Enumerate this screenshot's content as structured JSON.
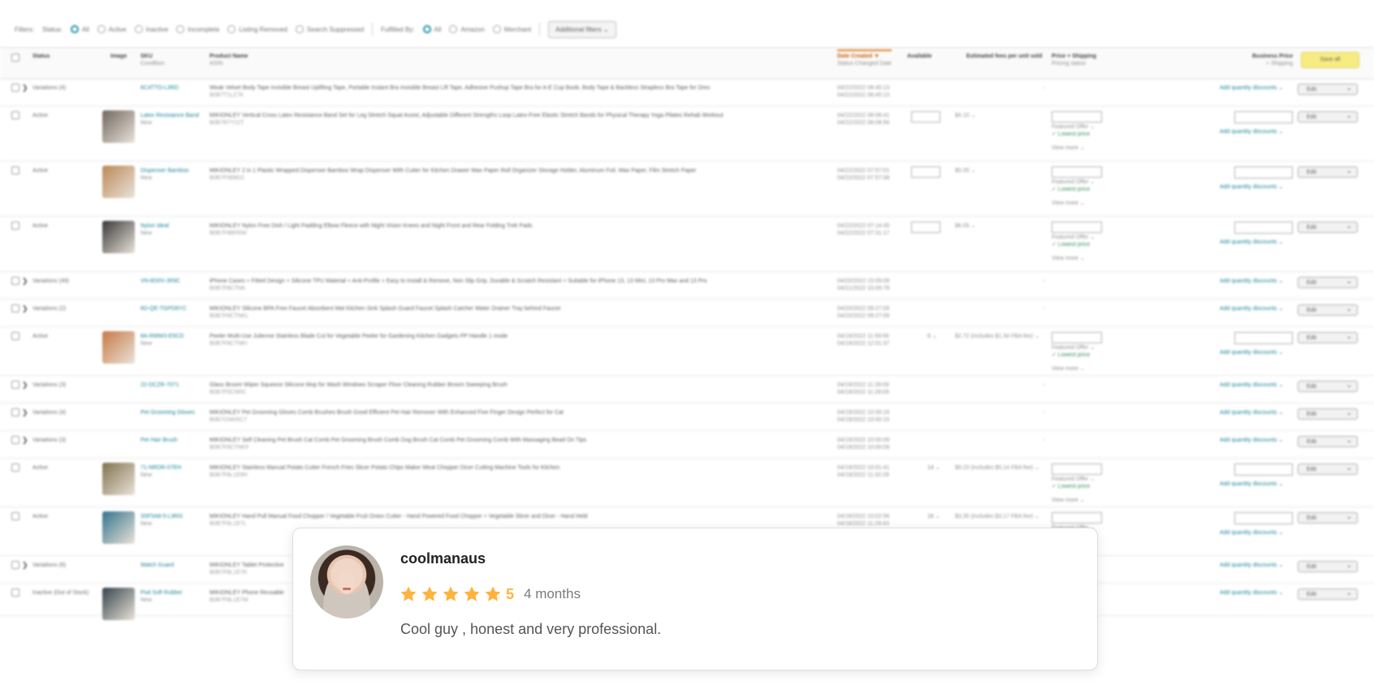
{
  "filters": {
    "label": "Filters:",
    "status_label": "Status:",
    "status_options": [
      "All",
      "Active",
      "Inactive",
      "Incomplete",
      "Listing Removed",
      "Search Suppressed"
    ],
    "fulfilled_label": "Fulfilled By:",
    "fulfilled_options": [
      "All",
      "Amazon",
      "Merchant"
    ],
    "additional": "Additional filters ⌄"
  },
  "table_headers": {
    "status": "Status",
    "image": "Image",
    "sku": "SKU",
    "sku_sub": "Condition",
    "product": "Product Name",
    "product_sub": "ASIN",
    "date": "Date Created ▼",
    "date_sub": "Status Changed Date",
    "available": "Available",
    "fees": "Estimated fees per unit sold",
    "price": "Price + Shipping",
    "price_sub": "Pricing status",
    "business": "Business Price",
    "business_sub": "+ Shipping",
    "save_all": "Save all"
  },
  "rows": [
    {
      "status": "Variations (4)",
      "variation": true,
      "sku": "6C4TTO-L3RD",
      "cond": "",
      "name": "Weak Velvet Body Tape Invisible Breast Uplifting Tape, Portable Instant Bra Invisible Breast Lift Tape, Adhesive Pushup Tape Bra for A-E Cup Boob, Body Tape & Backless Strapless Bra Tape for Dres",
      "asin": "B0B7T1LZ7K",
      "date": "04/22/2022 08:45:13",
      "date2": "04/22/2022 08:45:13"
    },
    {
      "status": "Active",
      "sku": "Latex Resistance Band",
      "cond": "New",
      "name": "MIKIONLEY Vertical Cross Latex Resistance Band Set for Leg Stretch Squat Assist, Adjustable Different Strengths Loop Latex-Free Elastic Stretch Bands for Physical Therapy Yoga Pilates Rehab Workout",
      "asin": "B0B7R7Y11T",
      "date": "04/22/2022 08:08:41",
      "date2": "04/22/2022 08:08:50",
      "fees": "$4.10",
      "avail": true,
      "price": "10.91"
    },
    {
      "status": "Active",
      "sku": "Dispenser Bamboo",
      "cond": "New",
      "name": "MIKIONLEY 2 in 1 Plastic Wrapped Dispenser Bamboo Wrap Dispenser With Cutter for Kitchen Drawer Wax Paper Roll Organizer Storage Holder, Aluminum Foil, Wax Paper, Film Stretch Paper",
      "asin": "B0B7F5B8D2",
      "date": "04/22/2022 07:57:01",
      "date2": "04/22/2022 07:57:08",
      "fees": "$5.05",
      "avail": true,
      "price": "19.99"
    },
    {
      "status": "Active",
      "sku": "Nylon Ideal",
      "cond": "New",
      "name": "MIKIONLEY Nylon Free Dish / Light Padding Elbow Fleece with Night Vision Knees and Night Front and Rear Folding Trek Pads",
      "asin": "B0B7F8BFRW",
      "date": "04/22/2022 07:14:45",
      "date2": "04/22/2022 07:31:17",
      "fees": "$6.05",
      "avail": true,
      "price": "28.99"
    },
    {
      "status": "Variations (49)",
      "variation": true,
      "sku": "VN-8D0V-JR9C",
      "cond": "",
      "name": "iPhone Cases + Fitted Design + Silicone TPU Material + Anti-Profile + Easy to Install & Remove, Non Slip Grip, Durable & Scratch Resistant + Suitable for iPhone 13, 13 Mini, 13 Pro Max and 13 Pro",
      "asin": "B0B7F8CTNK",
      "date": "04/20/2022 15:09:09",
      "date2": "04/21/2022 15:09:78"
    },
    {
      "status": "Variations (2)",
      "variation": true,
      "sku": "6D-QE-TGPD6YC",
      "cond": "",
      "name": "MIKIONLEY Silicone BPA Free Faucet Absorbent Mat Kitchen Sink Splash Guard Faucet Splash Catcher Water Drainer Tray behind Faucet",
      "asin": "B0B7F8CTNKL",
      "date": "04/20/2022 09:27:09",
      "date2": "04/20/2022 09:27:09"
    },
    {
      "status": "Active",
      "sku": "8A-RMW3-E5CD",
      "cond": "New",
      "name": "Peeler Multi-Use Julienne Stainless Blade Cut for Vegetable Peeler for Gardening Kitchen Gadgets PP Handle 1 mode",
      "asin": "B0B7F8CTNKI",
      "date": "04/19/2022 11:59:56",
      "date2": "04/19/2022 12:01:37",
      "fees": "$2.72 (includes $1.34 FBA fee)",
      "avail_text": "0",
      "price": "10.91"
    },
    {
      "status": "Variations (3)",
      "variation": true,
      "sku": "22-DCZR-7071",
      "cond": "",
      "name": "Glass Broom Wiper Squeeze Silicone Mop for Wash Windows Scraper Floor Cleaning Rubber Broom Sweeping Brush",
      "asin": "B0B7F5CNRC",
      "date": "04/19/2022 11:28:09",
      "date2": "04/19/2022 11:28:09"
    },
    {
      "status": "Variations (4)",
      "variation": true,
      "sku": "Pet Grooming Gloves",
      "cond": "",
      "name": "MIKIONLEY Pet Grooming Gloves Comb Brushes Brush Good Efficient Pet Hair Remover With Enhanced Five Finger Design Perfect for Cat",
      "asin": "B0B7CNKRC7",
      "date": "04/19/2022 10:00:16",
      "date2": "04/19/2022 10:00:15"
    },
    {
      "status": "Variations (3)",
      "variation": true,
      "sku": "Pet Hair Brush",
      "cond": "",
      "name": "MIKIONLEY Self Cleaning Pet Brush Cat Comb Pet Grooming Brush Comb Dog Brush Cat Comb Pet Grooming Comb With Massaging Bead On Tips",
      "asin": "B0B7F8CTNKF",
      "date": "04/19/2022 10:00:09",
      "date2": "04/19/2022 10:00:09"
    },
    {
      "status": "Active",
      "sku": "71-NRDR-07EH",
      "cond": "New",
      "name": "MIKIONLEY Stainless Manual Potato Cutter French Fries Slicer Potato Chips Maker Meat Chopper Dicer Cutting Machine Tools for Kitchen",
      "asin": "B0B7F8L1E9H",
      "date": "04/19/2022 10:01:41",
      "date2": "04/19/2022 11:32:28",
      "fees": "$9.23 (includes $5.14 FBA fee)",
      "avail_text": "14",
      "price": "49.99"
    },
    {
      "status": "Active",
      "sku": "3SF5A8-5-L9RG",
      "cond": "New",
      "name": "MIKIONLEY Hand Pull Manual Food Chopper / Vegetable Fruit Onion Cutter - Hand Powered Food Chopper + Vegetable Slicer and Dicer - Hand Held",
      "asin": "B0B7F8L1E7L",
      "date": "04/18/2022 10:02:56",
      "date2": "04/18/2022 11:29:43",
      "fees": "$3.35 (includes $3.17 FBA fee)",
      "avail_text": "16",
      "price": "13.98"
    },
    {
      "status": "Variations (6)",
      "variation": true,
      "sku": "Watch Guard",
      "cond": "",
      "name": "MIKIONLEY Tablet Protective",
      "asin": "B0B7F8L1E7K",
      "date": "",
      "date2": ""
    },
    {
      "status": "Inactive (Out of Stock)",
      "sku": "Pod Soft Rubber",
      "cond": "New",
      "name": "MIKIONLEY Phone Reusable",
      "asin": "B0B7F8L1E7M",
      "date": "",
      "date2": ""
    }
  ],
  "row_ui": {
    "edit": "Edit",
    "qd": "Add quantity discounts",
    "view_more": "View more ⌄",
    "lowest": "Lowest price",
    "featured": "Featured Offer"
  },
  "review": {
    "name": "coolmanaus",
    "rating": "5",
    "stars": 5,
    "time": "4 months",
    "text": "Cool guy , honest and very professional.",
    "star_color": "#ffb33e"
  }
}
